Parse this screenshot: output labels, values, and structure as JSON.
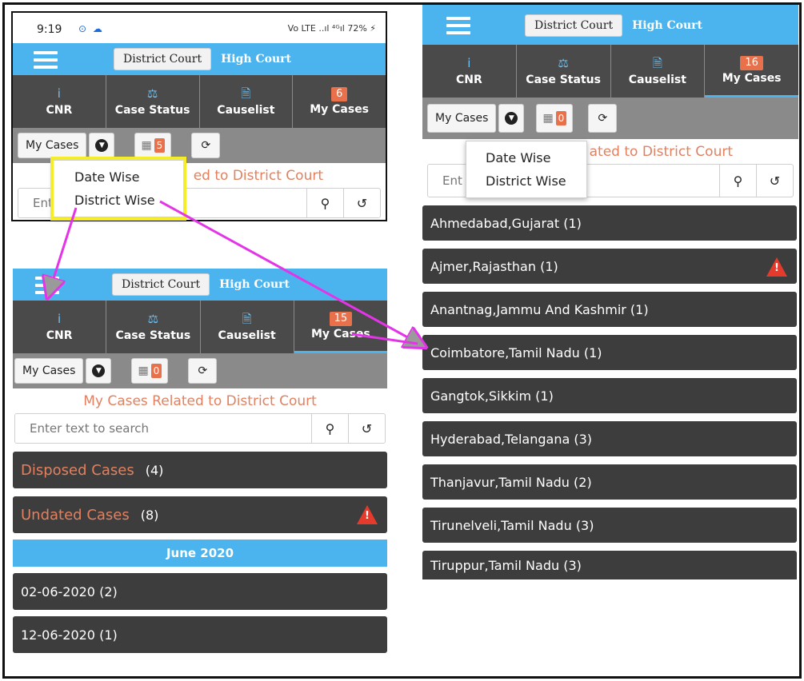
{
  "panel1": {
    "status": {
      "time": "9:19",
      "icons": "⊙ ☁",
      "right": "Vo LTE ..ıl ⁴ᴳıl 72% ⚡"
    },
    "court_tabs": {
      "district": "District Court",
      "high": "High Court"
    },
    "nav": [
      {
        "icon": "i",
        "label": "CNR"
      },
      {
        "icon": "⚖",
        "label": "Case Status"
      },
      {
        "icon": "🗎",
        "label": "Causelist"
      },
      {
        "badge": "6",
        "label": "My Cases"
      }
    ],
    "toolbar": {
      "mycases": "My Cases",
      "cal_count": "5"
    },
    "subtitle": "ed to District Court",
    "search_placeholder": "Ent",
    "dropdown": [
      "Date Wise",
      "District Wise"
    ]
  },
  "panel2": {
    "court_tabs": {
      "district": "District Court",
      "high": "High Court"
    },
    "nav": [
      {
        "icon": "i",
        "label": "CNR"
      },
      {
        "icon": "⚖",
        "label": "Case Status"
      },
      {
        "icon": "🗎",
        "label": "Causelist"
      },
      {
        "badge": "15",
        "label": "My Cases"
      }
    ],
    "toolbar": {
      "mycases": "My Cases",
      "cal_count": "0"
    },
    "subtitle": "My Cases Related to District Court",
    "search_placeholder": "Enter text to search",
    "disposed": {
      "label": "Disposed Cases",
      "count": "(4)"
    },
    "undated": {
      "label": "Undated Cases",
      "count": "(8)"
    },
    "month": "June 2020",
    "dates": [
      "02-06-2020 (2)",
      "12-06-2020 (1)"
    ]
  },
  "panel3": {
    "court_tabs": {
      "district": "District Court",
      "high": "High Court"
    },
    "nav": [
      {
        "icon": "i",
        "label": "CNR"
      },
      {
        "icon": "⚖",
        "label": "Case Status"
      },
      {
        "icon": "🗎",
        "label": "Causelist"
      },
      {
        "badge": "16",
        "label": "My Cases"
      }
    ],
    "toolbar": {
      "mycases": "My Cases",
      "cal_count": "0"
    },
    "subtitle": "ated to District Court",
    "search_placeholder": "Ent",
    "dropdown": [
      "Date Wise",
      "District Wise"
    ],
    "districts": [
      "Ahmedabad,Gujarat (1)",
      "Ajmer,Rajasthan (1)",
      "Anantnag,Jammu And Kashmir (1)",
      "Coimbatore,Tamil Nadu (1)",
      "Gangtok,Sikkim (1)",
      "Hyderabad,Telangana (3)",
      "Thanjavur,Tamil Nadu (2)",
      "Tirunelveli,Tamil Nadu (3)",
      "Tiruppur,Tamil Nadu (3)"
    ]
  },
  "colors": {
    "topbar": "#4bb4ee",
    "navbar": "#4a4a4a",
    "toolbar": "#8a8a8a",
    "accent_orange": "#e3805f",
    "arrow": "#e434e8",
    "highlight": "#f5ec2b"
  },
  "icons": {
    "menu": "hamburger-icon",
    "search": "search-icon",
    "reset": "reset-icon",
    "refresh": "refresh-icon",
    "calendar": "calendar-icon",
    "warning": "warning-icon"
  }
}
